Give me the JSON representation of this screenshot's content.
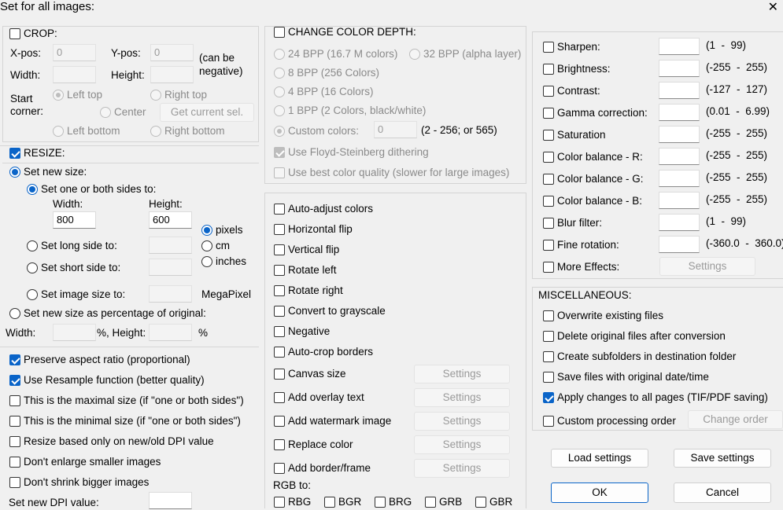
{
  "window": {
    "title": "Set for all images:"
  },
  "crop": {
    "label": "CROP:",
    "xpos_label": "X-pos:",
    "xpos_value": "0",
    "ypos_label": "Y-pos:",
    "ypos_value": "0",
    "can_be_negative": "(can be\nnegative)",
    "width_label": "Width:",
    "height_label": "Height:",
    "start_corner_label": "Start\ncorner:",
    "left_top": "Left top",
    "right_top": "Right top",
    "center": "Center",
    "get_current_sel": "Get current sel.",
    "left_bottom": "Left bottom",
    "right_bottom": "Right bottom"
  },
  "resize": {
    "label": "RESIZE:",
    "set_new_size": "Set new size:",
    "set_one_or_both": "Set one or both sides to:",
    "width_label": "Width:",
    "width_value": "800",
    "height_label": "Height:",
    "height_value": "600",
    "pixels": "pixels",
    "cm": "cm",
    "inches": "inches",
    "set_long_side": "Set long side to:",
    "set_short_side": "Set short side to:",
    "set_image_size": "Set image size to:",
    "megapixel": "MegaPixel",
    "set_percentage": "Set new size as percentage of original:",
    "pct_width_label": "Width:",
    "pct_height_label": "%, Height:",
    "pct_suffix": "%"
  },
  "resize_options": [
    {
      "label": "Preserve aspect ratio (proportional)",
      "checked": true
    },
    {
      "label": "Use Resample function (better quality)",
      "checked": true
    },
    {
      "label": "This is the maximal size (if \"one or both sides\")",
      "checked": false
    },
    {
      "label": "This is the minimal size (if \"one or both sides\")",
      "checked": false
    },
    {
      "label": "Resize based only on new/old DPI value",
      "checked": false
    },
    {
      "label": "Don't enlarge smaller images",
      "checked": false
    },
    {
      "label": "Don't shrink bigger images",
      "checked": false
    }
  ],
  "set_dpi_label": "Set new DPI value:",
  "color_depth": {
    "label": "CHANGE COLOR DEPTH:",
    "bpp24": "24 BPP (16.7 M colors)",
    "bpp32": "32 BPP (alpha layer)",
    "bpp8": "8 BPP (256 Colors)",
    "bpp4": "4 BPP (16 Colors)",
    "bpp1": "1 BPP (2 Colors, black/white)",
    "custom": "Custom colors:",
    "custom_value": "0",
    "custom_range": "(2 - 256; or 565)",
    "floyd": "Use Floyd-Steinberg dithering",
    "best_quality": "Use best color quality (slower for large images)"
  },
  "transforms": [
    {
      "label": "Auto-adjust colors"
    },
    {
      "label": "Horizontal flip"
    },
    {
      "label": "Vertical flip"
    },
    {
      "label": "Rotate left"
    },
    {
      "label": "Rotate right"
    },
    {
      "label": "Convert to grayscale"
    },
    {
      "label": "Negative"
    },
    {
      "label": "Auto-crop borders"
    }
  ],
  "transforms_settings": [
    {
      "label": "Canvas size",
      "button": "Settings"
    },
    {
      "label": "Add overlay text",
      "button": "Settings"
    },
    {
      "label": "Add watermark image",
      "button": "Settings"
    },
    {
      "label": "Replace color",
      "button": "Settings"
    },
    {
      "label": "Add border/frame",
      "button": "Settings"
    }
  ],
  "rgb": {
    "label": "RGB to:",
    "options": [
      "RBG",
      "BGR",
      "BRG",
      "GRB",
      "GBR"
    ]
  },
  "effects": [
    {
      "label": "Sharpen:",
      "range": "(1  -  99)"
    },
    {
      "label": "Brightness:",
      "range": "(-255  -  255)"
    },
    {
      "label": "Contrast:",
      "range": "(-127  -  127)"
    },
    {
      "label": "Gamma correction:",
      "range": "(0.01  -  6.99)"
    },
    {
      "label": "Saturation",
      "range": "(-255  -  255)"
    },
    {
      "label": "Color balance - R:",
      "range": "(-255  -  255)"
    },
    {
      "label": "Color balance - G:",
      "range": "(-255  -  255)"
    },
    {
      "label": "Color balance - B:",
      "range": "(-255  -  255)"
    },
    {
      "label": "Blur filter:",
      "range": "(1  -  99)"
    },
    {
      "label": "Fine rotation:",
      "range": "(-360.0  -  360.0)"
    }
  ],
  "more_effects": {
    "label": "More Effects:",
    "button": "Settings"
  },
  "misc": {
    "label": "MISCELLANEOUS:",
    "items": [
      {
        "label": "Overwrite existing files",
        "checked": false
      },
      {
        "label": "Delete original files after conversion",
        "checked": false
      },
      {
        "label": "Create subfolders in destination folder",
        "checked": false
      },
      {
        "label": "Save files with original date/time",
        "checked": false
      },
      {
        "label": "Apply changes to all pages (TIF/PDF saving)",
        "checked": true
      }
    ],
    "custom_order": "Custom processing order",
    "change_order": "Change order"
  },
  "buttons": {
    "load": "Load settings",
    "save": "Save settings",
    "ok": "OK",
    "cancel": "Cancel"
  },
  "colors": {
    "accent": "#0a64c8",
    "background": "#f0f0f0"
  }
}
